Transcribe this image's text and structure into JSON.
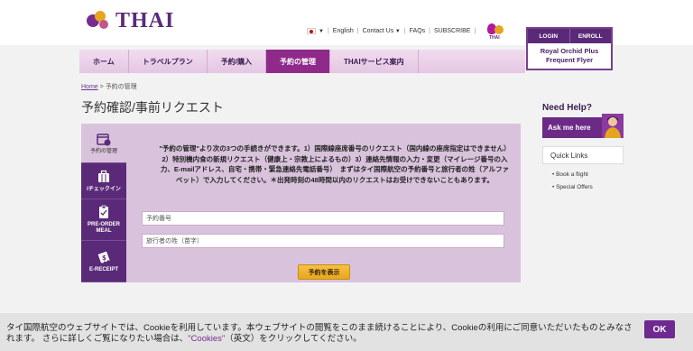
{
  "brand": {
    "name": "THAI"
  },
  "utility": {
    "language": "English",
    "contact": "Contact Us",
    "faqs": "FAQs",
    "subscribe": "SUBSCRIBE",
    "star_alliance": "THAI"
  },
  "account": {
    "login": "LOGIN",
    "enroll": "ENROLL",
    "program_line1": "Royal Orchid Plus",
    "program_line2": "Frequent Flyer"
  },
  "nav": [
    {
      "label": "ホーム",
      "active": false
    },
    {
      "label": "トラベルプラン",
      "active": false
    },
    {
      "label": "予約/購入",
      "active": false
    },
    {
      "label": "予約の管理",
      "active": true
    },
    {
      "label": "THAIサービス案内",
      "active": false
    }
  ],
  "breadcrumb": {
    "home": "Home",
    "sep": ">",
    "current": "予約の管理"
  },
  "page_title": "予約確認/事前リクエスト",
  "tabs": [
    {
      "label": "予約の管理",
      "icon": "calendar-icon",
      "active": true
    },
    {
      "label": "Iチェックイン",
      "icon": "suitcase-icon",
      "active": false
    },
    {
      "label": "PRE-ORDER MEAL",
      "icon": "clipboard-icon",
      "active": false
    },
    {
      "label": "E-RECEIPT",
      "icon": "receipt-icon",
      "active": false
    }
  ],
  "form": {
    "description": "\"予約の管理\"より次の3つの手続きができます。1）国際線座席番号のリクエスト（国内線の座席指定はできません）2）特別機内食の新規リクエスト（健康上・宗教上によるもの）3）連絡先情報の入力・変更（マイレージ番号の入力、E-mailアドレス、自宅・携帯・緊急連絡先電話番号）　まずはタイ国際航空の予約番号と旅行者の姓（アルファベット）で入力してください。＊出発時刻の48時間以内のリクエストはお受けできないこともあります。",
    "booking_placeholder": "予約番号",
    "lastname_placeholder": "旅行者の姓（苗字）",
    "submit_label": "予約を表示"
  },
  "sidebar": {
    "need_help": "Need Help?",
    "ask_me": "Ask me here",
    "quick_links_title": "Quick Links",
    "quick_links": [
      "Book a flight",
      "Special Offers"
    ]
  },
  "cookie": {
    "line1": "タイ国際航空のウェブサイトでは、Cookieを利用しています。本ウェブサイトの閲覧をこのまま続けることにより、Cookieの利用にご同意いただいたものとみなされます。 さらに詳しくご覧になりたい場合は、",
    "link": "\"Cookies\"",
    "line2": "（英文）をクリックしてください。",
    "ok": "OK"
  },
  "colors": {
    "brand_purple": "#5a2a78",
    "accent_magenta": "#8f2a8a",
    "gold": "#e6a51e",
    "panel": "#d9c3dc"
  }
}
